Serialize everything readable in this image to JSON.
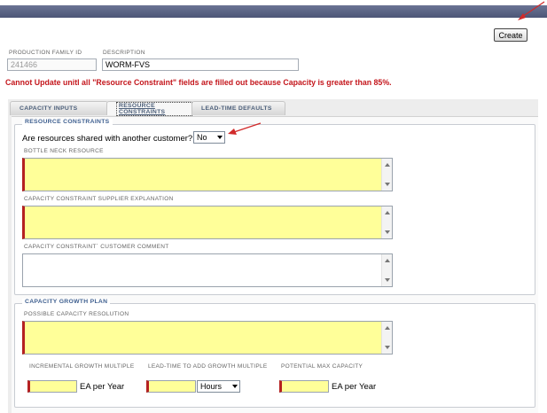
{
  "header": {
    "create_label": "Create"
  },
  "family": {
    "id_label": "PRODUCTION FAMILY ID",
    "id_value": "241466",
    "description_label": "DESCRIPTION",
    "description_value": "WORM-FVS"
  },
  "error_message": "Cannot Update unitl all \"Resource Constraint\" fields are filled out because Capacity is greater than 85%.",
  "tabs": [
    {
      "label": "CAPACITY INPUTS"
    },
    {
      "label": "RESOURCE CONSTRAINTS",
      "active": true
    },
    {
      "label": "LEAD-TIME DEFAULTS"
    }
  ],
  "resource_constraints": {
    "legend": "RESOURCE CONSTRAINTS",
    "question": "Are resources shared with another customer?",
    "shared_value": "No",
    "bottleneck_label": "BOTTLE NECK RESOURCE",
    "bottleneck_value": "",
    "supplier_expl_label": "CAPACITY CONSTRAINT SUPPLIER EXPLANATION",
    "supplier_expl_value": "",
    "customer_comment_label": "CAPACITY CONSTRAINT` CUSTOMER COMMENT",
    "customer_comment_value": ""
  },
  "growth_plan": {
    "legend": "CAPACITY GROWTH PLAN",
    "resolution_label": "POSSIBLE CAPACITY RESOLUTION",
    "resolution_value": "",
    "incremental_label": "INCREMENTAL GROWTH MULTIPLE",
    "incremental_value": "",
    "incremental_unit": "EA per Year",
    "leadtime_label": "LEAD-TIME TO ADD GROWTH MULTIPLE",
    "leadtime_value": "",
    "leadtime_unit": "Hours",
    "potential_label": "POTENTIAL MAX CAPACITY",
    "potential_value": "",
    "potential_unit": "EA per Year"
  },
  "colors": {
    "required_fill": "#ffff99",
    "error_text": "#c4161c",
    "arrow": "#d12a2a"
  },
  "icons": [
    "arrow-annotation-icon",
    "dropdown-arrow-icon",
    "scroll-up-icon",
    "scroll-down-icon"
  ]
}
